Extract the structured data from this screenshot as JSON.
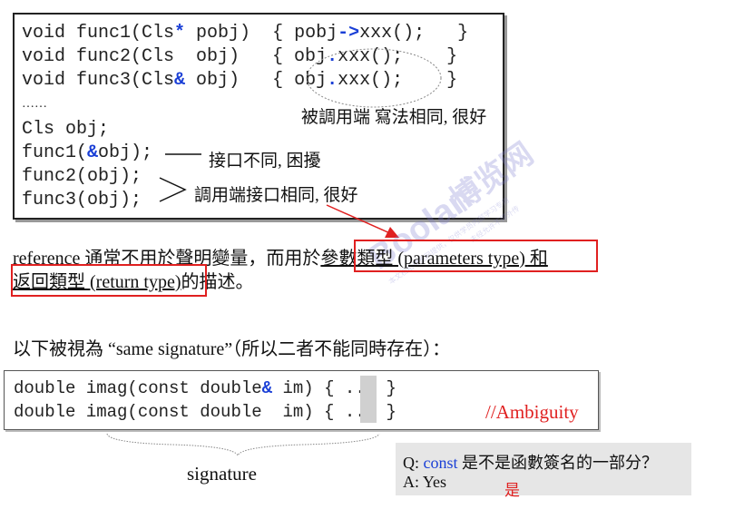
{
  "code": {
    "lines": [
      {
        "pre": "void func1(Cls",
        "kw": "*",
        "mid": " pobj)  { pobj",
        "kw2": "->",
        "post": "xxx();   }"
      },
      {
        "pre": "void func2(Cls  obj)   { obj",
        "kw": ".",
        "post": "xxx();    }"
      },
      {
        "pre": "void func3(Cls",
        "kw": "&",
        "mid": " obj)   { obj",
        "kw2": ".",
        "post": "xxx();    }"
      },
      {
        "text": "……"
      },
      {
        "text": "Cls obj;"
      },
      {
        "pre": "func1(",
        "kw": "&",
        "post": "obj);"
      },
      {
        "text": "func2(obj);"
      },
      {
        "text": "func3(obj);"
      }
    ],
    "note_caller": "被調用端 寫法相同, 很好",
    "note_interface_diff": "接口不同, 困擾",
    "note_caller_same": "調用端接口相同, 很好"
  },
  "watermark": {
    "text_cn": "博览网",
    "text_en": "Boolan",
    "line1": "本文档由博览网提供，仅供学员内部学习专用",
    "line2": "未经允许不得外传"
  },
  "paragraph": {
    "p1": "reference 通常不用於聲明變量，而用於",
    "highlight1": "參數類型 (parameters type)",
    "p2": " 和",
    "highlight2": "返回類型 (return type)",
    "p3": "的描述。"
  },
  "same_sig": {
    "intro": "以下被視為 “same signature”（所以二者不能同時存在）："
  },
  "sig_code": {
    "line1_pre": "double imag(const double",
    "line1_kw": "&",
    "line1_post": " im) { ... }",
    "line2": "double imag(const double  im) { ... }",
    "ambiguity": "//Ambiguity",
    "signature_label": "signature"
  },
  "qa": {
    "q_prefix": "Q: ",
    "q_kw": "const",
    "q_rest": " 是不是函數簽名的一部分？",
    "a": "A: Yes",
    "handwritten": "是"
  },
  "colors": {
    "accent_blue": "#1a3fd6",
    "highlight_red": "#e02020",
    "arrow_red": "#e02020"
  }
}
